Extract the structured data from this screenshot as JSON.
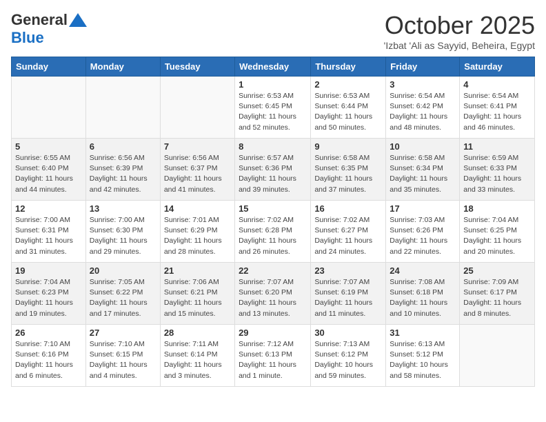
{
  "header": {
    "logo_general": "General",
    "logo_blue": "Blue",
    "month": "October 2025",
    "location": "'Izbat 'Ali as Sayyid, Beheira, Egypt"
  },
  "days_of_week": [
    "Sunday",
    "Monday",
    "Tuesday",
    "Wednesday",
    "Thursday",
    "Friday",
    "Saturday"
  ],
  "weeks": [
    [
      {
        "day": "",
        "info": ""
      },
      {
        "day": "",
        "info": ""
      },
      {
        "day": "",
        "info": ""
      },
      {
        "day": "1",
        "info": "Sunrise: 6:53 AM\nSunset: 6:45 PM\nDaylight: 11 hours\nand 52 minutes."
      },
      {
        "day": "2",
        "info": "Sunrise: 6:53 AM\nSunset: 6:44 PM\nDaylight: 11 hours\nand 50 minutes."
      },
      {
        "day": "3",
        "info": "Sunrise: 6:54 AM\nSunset: 6:42 PM\nDaylight: 11 hours\nand 48 minutes."
      },
      {
        "day": "4",
        "info": "Sunrise: 6:54 AM\nSunset: 6:41 PM\nDaylight: 11 hours\nand 46 minutes."
      }
    ],
    [
      {
        "day": "5",
        "info": "Sunrise: 6:55 AM\nSunset: 6:40 PM\nDaylight: 11 hours\nand 44 minutes."
      },
      {
        "day": "6",
        "info": "Sunrise: 6:56 AM\nSunset: 6:39 PM\nDaylight: 11 hours\nand 42 minutes."
      },
      {
        "day": "7",
        "info": "Sunrise: 6:56 AM\nSunset: 6:37 PM\nDaylight: 11 hours\nand 41 minutes."
      },
      {
        "day": "8",
        "info": "Sunrise: 6:57 AM\nSunset: 6:36 PM\nDaylight: 11 hours\nand 39 minutes."
      },
      {
        "day": "9",
        "info": "Sunrise: 6:58 AM\nSunset: 6:35 PM\nDaylight: 11 hours\nand 37 minutes."
      },
      {
        "day": "10",
        "info": "Sunrise: 6:58 AM\nSunset: 6:34 PM\nDaylight: 11 hours\nand 35 minutes."
      },
      {
        "day": "11",
        "info": "Sunrise: 6:59 AM\nSunset: 6:33 PM\nDaylight: 11 hours\nand 33 minutes."
      }
    ],
    [
      {
        "day": "12",
        "info": "Sunrise: 7:00 AM\nSunset: 6:31 PM\nDaylight: 11 hours\nand 31 minutes."
      },
      {
        "day": "13",
        "info": "Sunrise: 7:00 AM\nSunset: 6:30 PM\nDaylight: 11 hours\nand 29 minutes."
      },
      {
        "day": "14",
        "info": "Sunrise: 7:01 AM\nSunset: 6:29 PM\nDaylight: 11 hours\nand 28 minutes."
      },
      {
        "day": "15",
        "info": "Sunrise: 7:02 AM\nSunset: 6:28 PM\nDaylight: 11 hours\nand 26 minutes."
      },
      {
        "day": "16",
        "info": "Sunrise: 7:02 AM\nSunset: 6:27 PM\nDaylight: 11 hours\nand 24 minutes."
      },
      {
        "day": "17",
        "info": "Sunrise: 7:03 AM\nSunset: 6:26 PM\nDaylight: 11 hours\nand 22 minutes."
      },
      {
        "day": "18",
        "info": "Sunrise: 7:04 AM\nSunset: 6:25 PM\nDaylight: 11 hours\nand 20 minutes."
      }
    ],
    [
      {
        "day": "19",
        "info": "Sunrise: 7:04 AM\nSunset: 6:23 PM\nDaylight: 11 hours\nand 19 minutes."
      },
      {
        "day": "20",
        "info": "Sunrise: 7:05 AM\nSunset: 6:22 PM\nDaylight: 11 hours\nand 17 minutes."
      },
      {
        "day": "21",
        "info": "Sunrise: 7:06 AM\nSunset: 6:21 PM\nDaylight: 11 hours\nand 15 minutes."
      },
      {
        "day": "22",
        "info": "Sunrise: 7:07 AM\nSunset: 6:20 PM\nDaylight: 11 hours\nand 13 minutes."
      },
      {
        "day": "23",
        "info": "Sunrise: 7:07 AM\nSunset: 6:19 PM\nDaylight: 11 hours\nand 11 minutes."
      },
      {
        "day": "24",
        "info": "Sunrise: 7:08 AM\nSunset: 6:18 PM\nDaylight: 11 hours\nand 10 minutes."
      },
      {
        "day": "25",
        "info": "Sunrise: 7:09 AM\nSunset: 6:17 PM\nDaylight: 11 hours\nand 8 minutes."
      }
    ],
    [
      {
        "day": "26",
        "info": "Sunrise: 7:10 AM\nSunset: 6:16 PM\nDaylight: 11 hours\nand 6 minutes."
      },
      {
        "day": "27",
        "info": "Sunrise: 7:10 AM\nSunset: 6:15 PM\nDaylight: 11 hours\nand 4 minutes."
      },
      {
        "day": "28",
        "info": "Sunrise: 7:11 AM\nSunset: 6:14 PM\nDaylight: 11 hours\nand 3 minutes."
      },
      {
        "day": "29",
        "info": "Sunrise: 7:12 AM\nSunset: 6:13 PM\nDaylight: 11 hours\nand 1 minute."
      },
      {
        "day": "30",
        "info": "Sunrise: 7:13 AM\nSunset: 6:12 PM\nDaylight: 10 hours\nand 59 minutes."
      },
      {
        "day": "31",
        "info": "Sunrise: 6:13 AM\nSunset: 5:12 PM\nDaylight: 10 hours\nand 58 minutes."
      },
      {
        "day": "",
        "info": ""
      }
    ]
  ]
}
